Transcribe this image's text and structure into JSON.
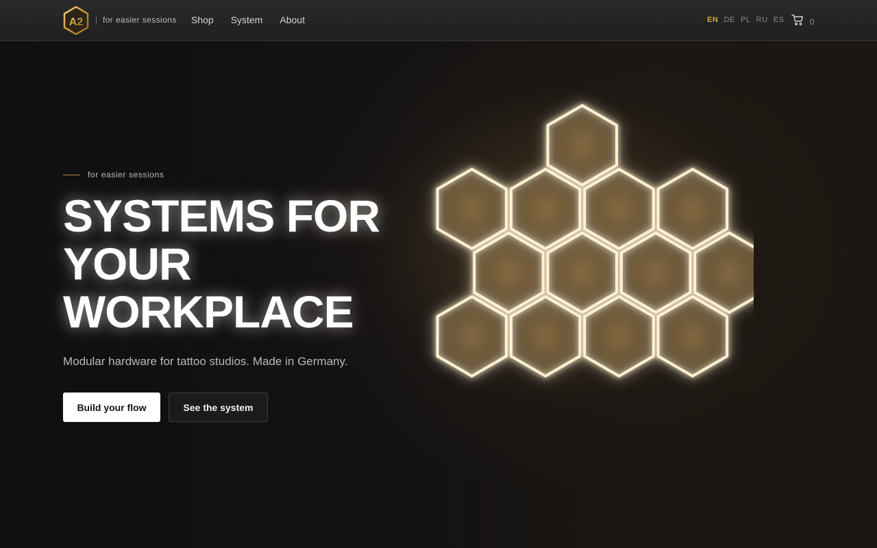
{
  "header": {
    "logo_text": "A2",
    "tagline": "for easier sessions",
    "nav": [
      "Shop",
      "System",
      "About"
    ],
    "languages": [
      "EN",
      "DE",
      "PL",
      "RU",
      "ES"
    ],
    "active_language": "EN",
    "cart_count": "0"
  },
  "hero": {
    "eyebrow": "for easier sessions",
    "headline": [
      "SYSTEMS FOR",
      "YOUR",
      "WORKPLACE"
    ],
    "subline": "Modular hardware for tattoo studios. Made in Germany.",
    "primary_cta": "Build your flow",
    "secondary_cta": "See the system"
  },
  "colors": {
    "accent_gold": "#d4a73a",
    "background": "#0e0e10",
    "hex_glow": "#fff1d2"
  },
  "icons": [
    "a2-logo-icon",
    "cart-icon"
  ]
}
